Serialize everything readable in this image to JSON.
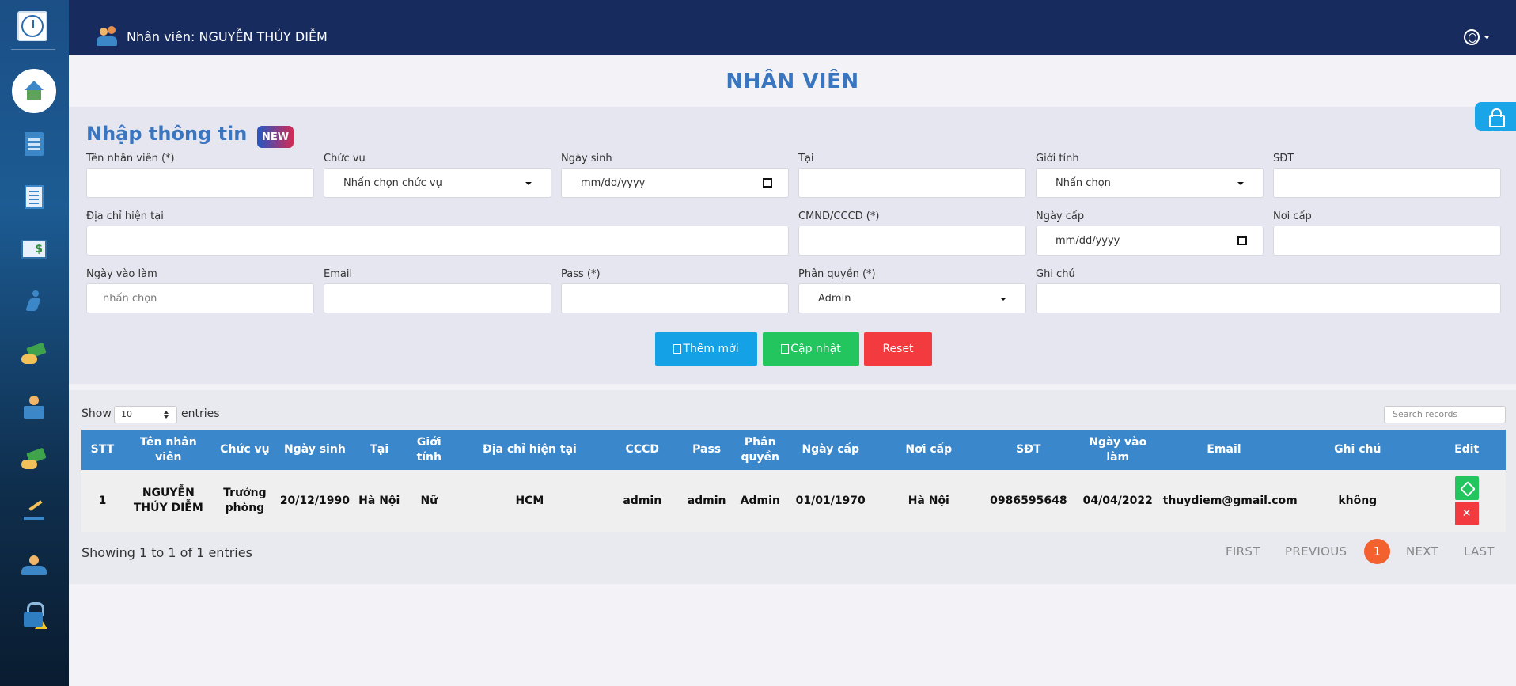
{
  "header": {
    "user_label": "Nhân viên: NGUYỄN THÚY DIỄM"
  },
  "sidebar": {
    "items": [
      {
        "icon": "home-icon"
      },
      {
        "icon": "building-icon"
      },
      {
        "icon": "document-icon"
      },
      {
        "icon": "ledger-icon"
      },
      {
        "icon": "runner-icon"
      },
      {
        "icon": "money-icon"
      },
      {
        "icon": "reader-icon"
      },
      {
        "icon": "money-hand-icon"
      },
      {
        "icon": "sign-icon"
      },
      {
        "icon": "people-icon"
      },
      {
        "icon": "lock-warning-icon"
      }
    ]
  },
  "page": {
    "title": "NHÂN VIÊN"
  },
  "form": {
    "title": "Nhập thông tin",
    "badge": "NEW",
    "fields": {
      "ten_label": "Tên nhân viên (*)",
      "chucvu_label": "Chức vụ",
      "chucvu_value": "Nhấn chọn chức vụ",
      "ngaysinh_label": "Ngày sinh",
      "ngaysinh_placeholder": "mm/dd/yyyy",
      "tai_label": "Tại",
      "gioitinh_label": "Giới tính",
      "gioitinh_value": "Nhấn chọn",
      "sdt_label": "SĐT",
      "diachi_label": "Địa chỉ hiện tại",
      "cmnd_label": "CMND/CCCD (*)",
      "ngaycap_label": "Ngày cấp",
      "ngaycap_placeholder": "mm/dd/yyyy",
      "noicap_label": "Nơi cấp",
      "ngayvaolam_label": "Ngày vào làm",
      "ngayvaolam_placeholder": "nhấn chọn",
      "email_label": "Email",
      "pass_label": "Pass (*)",
      "phanquyen_label": "Phân quyền (*)",
      "phanquyen_value": "Admin",
      "ghichu_label": "Ghi chú"
    },
    "buttons": {
      "add": "Thêm mới",
      "update": "Cập nhật",
      "reset": "Reset"
    }
  },
  "table": {
    "show_label": "Show",
    "page_size": "10",
    "entries_label": "entries",
    "search_placeholder": "Search records",
    "headers": [
      "STT",
      "Tên nhân viên",
      "Chức vụ",
      "Ngày sinh",
      "Tại",
      "Giới tính",
      "Địa chỉ hiện tại",
      "CCCD",
      "Pass",
      "Phân quyền",
      "Ngày cấp",
      "Nơi cấp",
      "SĐT",
      "Ngày vào làm",
      "Email",
      "Ghi chú",
      "Edit"
    ],
    "rows": [
      [
        "1",
        "NGUYỄN THÚY DIỄM",
        "Trưởng phòng",
        "20/12/1990",
        "Hà Nội",
        "Nữ",
        "HCM",
        "admin",
        "admin",
        "Admin",
        "01/01/1970",
        "Hà Nội",
        "0986595648",
        "04/04/2022",
        "thuydiem@gmail.com",
        "không"
      ]
    ],
    "edit_delete_glyph": "✕",
    "info": "Showing 1 to 1 of 1 entries",
    "pagination": {
      "first": "FIRST",
      "previous": "PREVIOUS",
      "current": "1",
      "next": "NEXT",
      "last": "LAST"
    }
  },
  "colors": {
    "header_bg": "#172b5f",
    "accent": "#3a76bf",
    "table_head": "#3b87cc",
    "add": "#14a1e6",
    "update": "#22c55e",
    "reset": "#f23a3f",
    "page_active": "#f2612e"
  }
}
